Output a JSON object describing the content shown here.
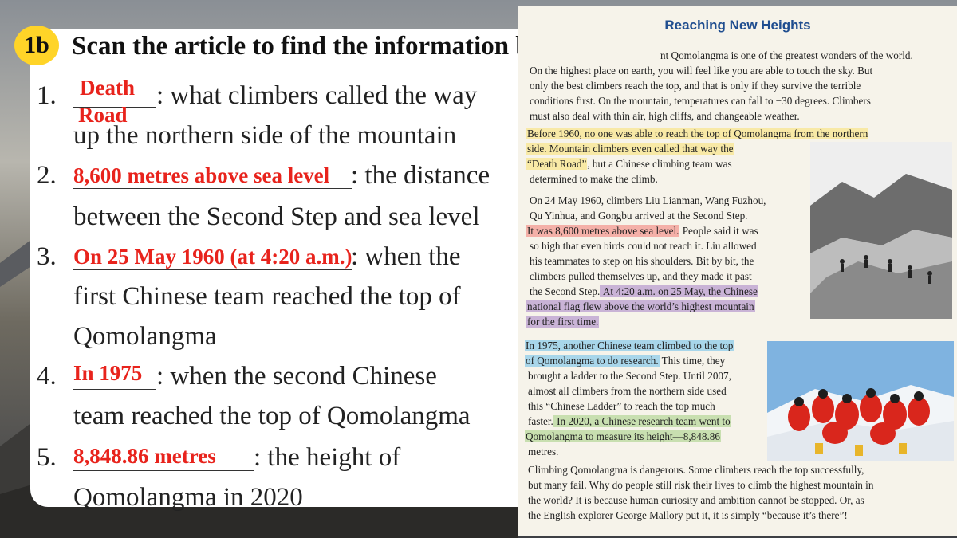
{
  "badge": "1b",
  "heading": "Scan the article to find the information below.",
  "questions": [
    {
      "num": "1.",
      "answer_lines": [
        "Death",
        "Road"
      ],
      "after": ": what climbers called the way",
      "line2": "up the northern side of the mountain"
    },
    {
      "num": "2.",
      "answer": "8,600 metres above sea level",
      "after": ": the distance",
      "line2": "between the Second Step and sea level"
    },
    {
      "num": "3.",
      "answer": "On 25 May 1960 (at 4:20 a.m.)",
      "after": ": when the",
      "line2": "first Chinese team reached the top of",
      "line3": "Qomolangma"
    },
    {
      "num": "4.",
      "answer": "In 1975",
      "after": ": when the second Chinese",
      "line2": "team reached the top of Qomolangma"
    },
    {
      "num": "5.",
      "answer": "8,848.86 metres",
      "after": ": the height of",
      "line2": "Qomolangma in 2020"
    }
  ],
  "article": {
    "title": "Reaching New Heights",
    "p1": [
      "nt Qomolangma is one of the greatest wonders of the world.",
      "On the highest place on earth, you will feel like you are able to touch the sky. But",
      "only the best climbers reach the top, and that is only if they survive the terrible",
      "conditions first. On the mountain, temperatures can fall to −30 degrees. Climbers",
      "must also deal with thin air, high cliffs, and changeable weather."
    ],
    "p2_hl": [
      "Before 1960, no one was able to reach the top of Qomolangma from the northern",
      "side. Mountain climbers even called that way the",
      "“Death Road”"
    ],
    "p2_rest_a": ", but a Chinese climbing team was",
    "p2_rest_b": "determined to make the climb.",
    "p3_a": "On 24 May 1960, climbers Liu Lianman, Wang Fuzhou,",
    "p3_b": "Qu Yinhua, and Gongbu arrived at the Second Step.",
    "p3_red": "It was 8,600 metres above sea level.",
    "p3_c": " People said it was",
    "p3_d": "so high that even birds could not reach it. Liu allowed",
    "p3_e": "his teammates to step on his shoulders. Bit by bit, the",
    "p3_f": "climbers pulled themselves up, and they made it past",
    "p3_g": "the Second Step.",
    "p3_purple": [
      " At 4:20 a.m. on 25 May, the Chinese",
      "national flag flew above the world’s highest mountain",
      "for the first time."
    ],
    "p4_blue": [
      "In 1975, another Chinese team climbed to the top",
      "of Qomolangma to do research."
    ],
    "p4_a": " This time, they",
    "p4_b": "brought a ladder to the Second Step. Until 2007,",
    "p4_c": "almost all climbers from the northern side used",
    "p4_d": "this “Chinese Ladder” to reach the top much",
    "p4_e": "faster.",
    "p4_green": [
      " In 2020, a Chinese research team went to",
      "Qomolangma to measure its height—8,848.86"
    ],
    "p4_f": "metres.",
    "p5": [
      "Climbing Qomolangma is dangerous. Some climbers reach the top successfully,",
      "but many fail. Why do people still risk their lives to climb the highest mountain in",
      "the world? It is because human curiosity and ambition cannot be stopped. Or, as",
      "the English explorer George Mallory put it, it is simply “because it’s there”!"
    ]
  }
}
